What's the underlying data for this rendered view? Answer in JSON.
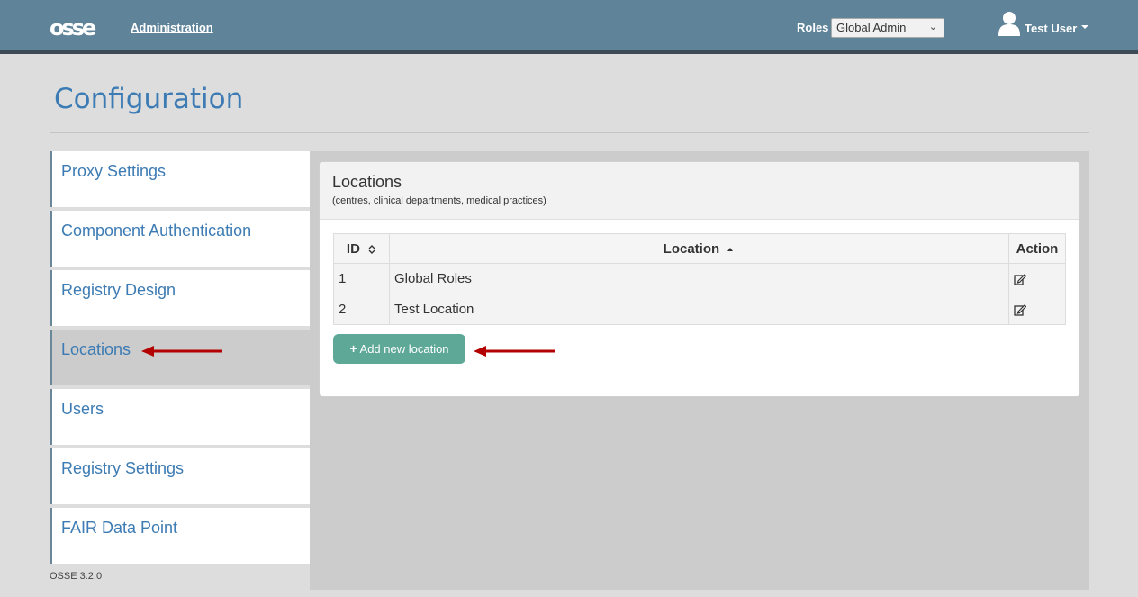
{
  "header": {
    "logo": "osse",
    "nav_admin": "Administration",
    "roles_label": "Roles",
    "roles_selected": "Global Admin",
    "user_name": "Test User",
    "bg_color": "#5f8399"
  },
  "page": {
    "title": "Configuration",
    "version": "OSSE 3.2.0"
  },
  "sidebar": {
    "items": [
      {
        "label": "Proxy Settings"
      },
      {
        "label": "Component Authentication"
      },
      {
        "label": "Registry Design"
      },
      {
        "label": "Locations",
        "active": true
      },
      {
        "label": "Users"
      },
      {
        "label": "Registry Settings"
      },
      {
        "label": "FAIR Data Point"
      }
    ]
  },
  "panel": {
    "title": "Locations",
    "subtitle": "(centres, clinical departments, medical practices)"
  },
  "table": {
    "headers": {
      "id": "ID",
      "location": "Location",
      "action": "Action"
    },
    "rows": [
      {
        "id": "1",
        "location": "Global Roles"
      },
      {
        "id": "2",
        "location": "Test Location"
      }
    ]
  },
  "add_button": {
    "label": "Add new location",
    "color": "#5ea898"
  },
  "annotation": {
    "arrow_color": "#b30000"
  },
  "icons": {
    "user": "user-icon",
    "edit": "edit-icon",
    "sort_both": "sort-icon",
    "sort_asc": "sort-asc-icon",
    "plus": "plus-icon"
  }
}
